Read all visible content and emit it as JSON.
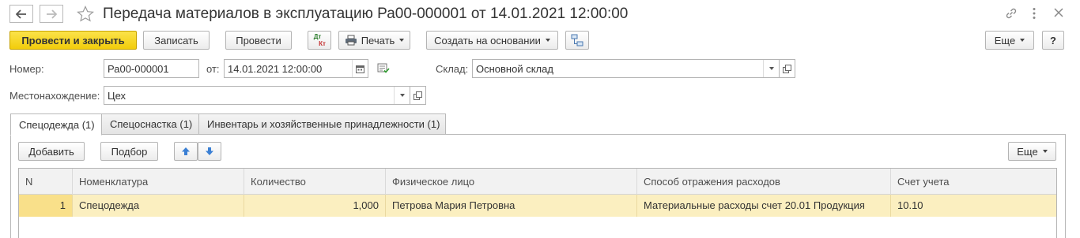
{
  "header": {
    "title": "Передача материалов в эксплуатацию Ра00-000001 от 14.01.2021 12:00:00"
  },
  "toolbar": {
    "post_and_close": "Провести и закрыть",
    "save": "Записать",
    "post": "Провести",
    "dt_label": "Дт",
    "kt_label": "Кт",
    "print": "Печать",
    "create_based_on": "Создать на основании",
    "more": "Еще",
    "help": "?"
  },
  "form": {
    "number_label": "Номер:",
    "number_value": "Ра00-000001",
    "from_label": "от:",
    "date_value": "14.01.2021 12:00:00",
    "warehouse_label": "Склад:",
    "warehouse_value": "Основной склад",
    "location_label": "Местонахождение:",
    "location_value": "Цех"
  },
  "tabs": [
    {
      "label": "Спецодежда (1)",
      "active": true
    },
    {
      "label": "Спецоснастка (1)",
      "active": false
    },
    {
      "label": "Инвентарь и хозяйственные принадлежности (1)",
      "active": false
    }
  ],
  "table_toolbar": {
    "add": "Добавить",
    "pick": "Подбор",
    "more": "Еще"
  },
  "table": {
    "columns": [
      "N",
      "Номенклатура",
      "Количество",
      "Физическое лицо",
      "Способ отражения расходов",
      "Счет учета"
    ],
    "rows": [
      [
        "1",
        "Спецодежда",
        "1,000",
        "Петрова Мария Петровна",
        "Материальные расходы счет 20.01 Продукция",
        "10.10"
      ]
    ]
  },
  "colors": {
    "primary_button": "#f5d20f",
    "selected_row": "#fbefc0",
    "arrow_blue": "#3a7fd4"
  }
}
